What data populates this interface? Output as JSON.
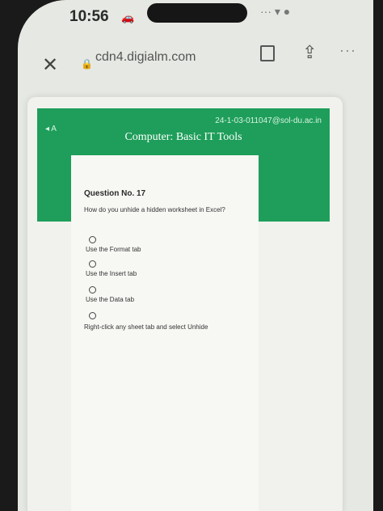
{
  "status_bar": {
    "time": "10:56",
    "car_glyph": "🚗",
    "right_glyphs": "··· ▾ ●"
  },
  "browser": {
    "close_glyph": "✕",
    "lock_glyph": "🔒",
    "url": "cdn4.digialm.com",
    "share_glyph": "⇪",
    "more_glyph": "···"
  },
  "header": {
    "left_icons": "◂ A",
    "user_id": "24-1-03-011047@sol-du.ac.in",
    "course_title": "Computer: Basic IT Tools"
  },
  "question": {
    "number": "Question No. 17",
    "text": "How do you unhide a hidden worksheet in Excel?",
    "options": [
      "Use the Format tab",
      "Use the Insert tab",
      "Use the Data tab",
      "Right-click any sheet tab and select Unhide"
    ]
  }
}
